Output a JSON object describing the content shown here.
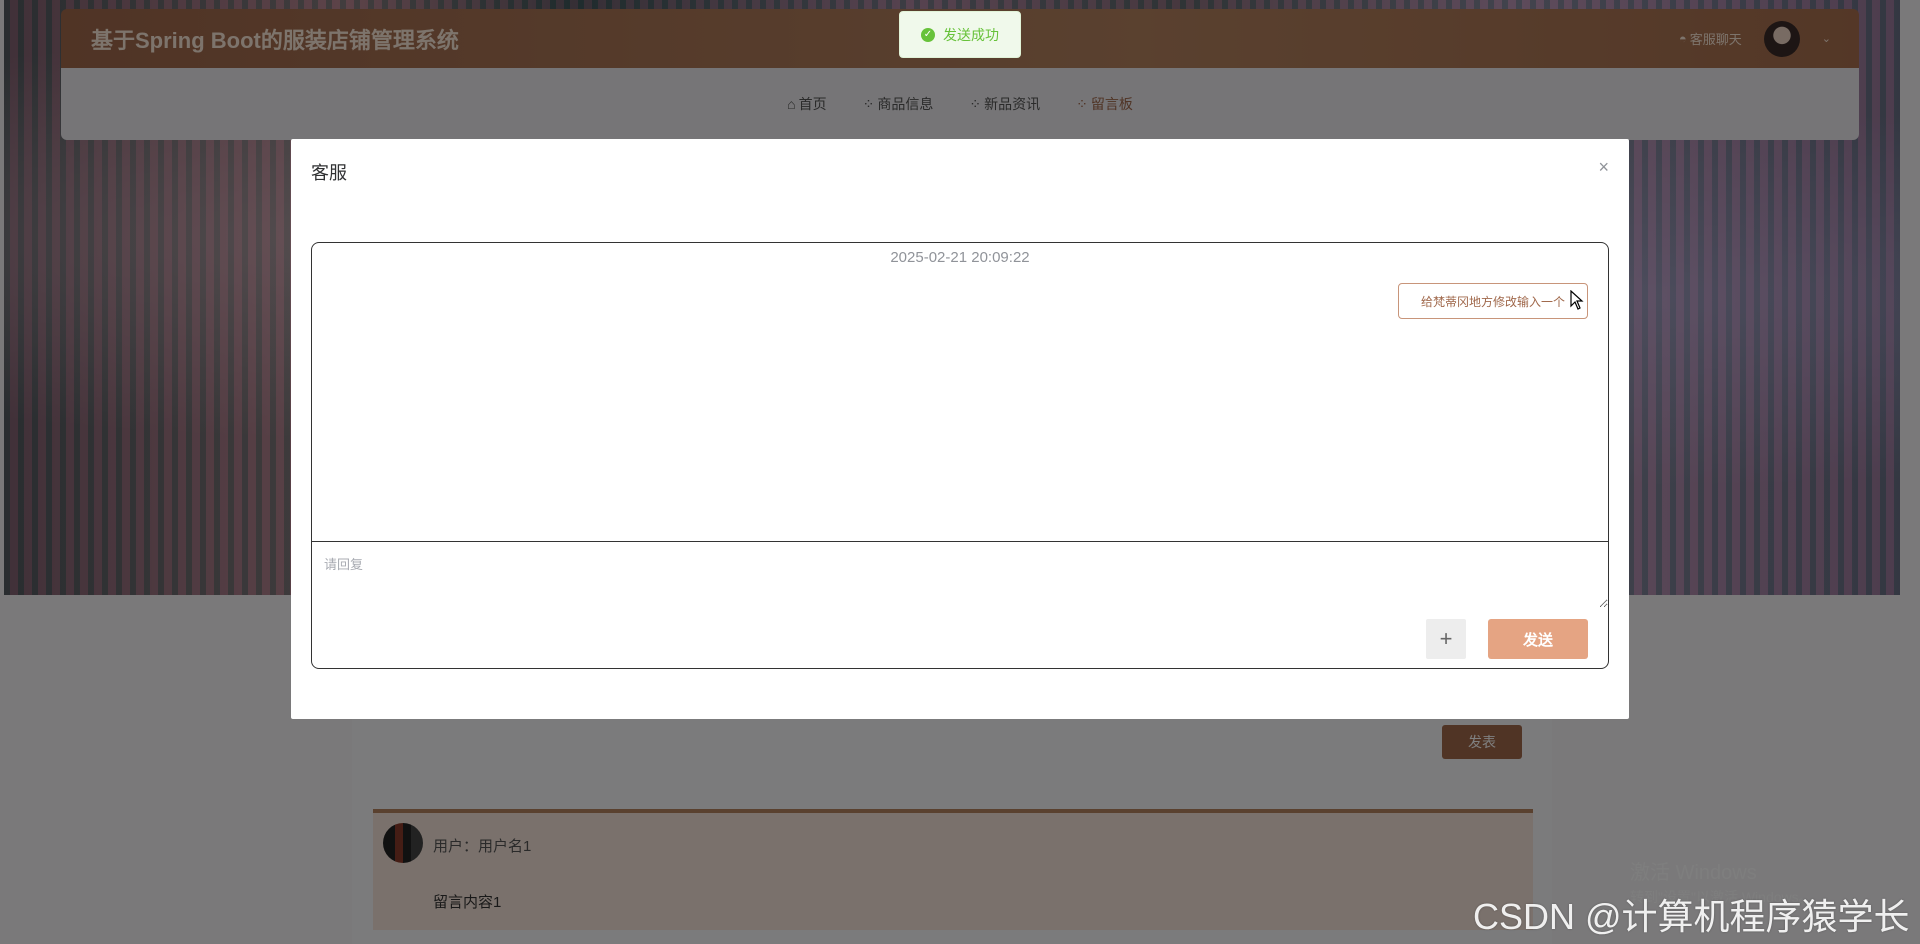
{
  "header": {
    "site_title": "基于Spring Boot的服装店铺管理系统",
    "chat_link": "客服聊天"
  },
  "nav": {
    "items": [
      {
        "label": "首页",
        "icon": "home-icon"
      },
      {
        "label": "商品信息",
        "icon": "grid-icon"
      },
      {
        "label": "新品资讯",
        "icon": "grid-icon"
      },
      {
        "label": "留言板",
        "icon": "grid-icon",
        "active": true
      }
    ]
  },
  "page": {
    "publish_label": "发表",
    "message": {
      "user": "用户：用户名1",
      "content": "留言内容1"
    }
  },
  "toast": {
    "text": "发送成功",
    "color": "#67c23a"
  },
  "dialog": {
    "title": "客服",
    "close_symbol": "×",
    "chat_time": "2025-02-21 20:09:22",
    "sent_message": "给梵蒂冈地方修改输入一个",
    "reply_placeholder": "请回复",
    "plus_label": "+",
    "send_label": "发送"
  },
  "colors": {
    "brand": "#a0684b",
    "send_button": "#e5a483"
  },
  "watermarks": {
    "windows_line1": "激活 Windows",
    "windows_line2": "转到\"设置\"以激活 Windows。",
    "csdn": "CSDN @计算机程序猿学长"
  }
}
